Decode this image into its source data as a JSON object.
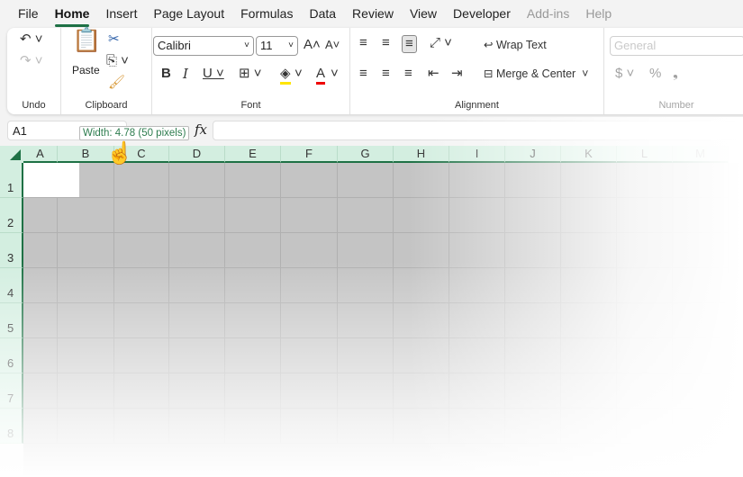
{
  "menu": [
    "File",
    "Home",
    "Insert",
    "Page Layout",
    "Formulas",
    "Data",
    "Review",
    "View",
    "Developer",
    "Add-ins",
    "Help"
  ],
  "ribbon": {
    "undo_label": "Undo",
    "clipboard_label": "Clipboard",
    "paste_label": "Paste",
    "font_label": "Font",
    "alignment_label": "Alignment",
    "number_label": "Number",
    "font_name": "Calibri",
    "font_size": "11",
    "wrap_text": "Wrap Text",
    "merge_center": "Merge & Center",
    "number_format": "General"
  },
  "formula_bar": {
    "name_box": "A1",
    "fx": "fx",
    "formula": ""
  },
  "tooltip": "Width: 4.78 (50 pixels)",
  "columns": [
    "A",
    "B",
    "C",
    "D",
    "E",
    "F",
    "G",
    "H",
    "I",
    "J",
    "K",
    "L",
    "M"
  ],
  "rows": [
    "1",
    "2",
    "3",
    "4",
    "5",
    "6",
    "7",
    "8"
  ],
  "colors": {
    "accent": "#1e7145",
    "header": "#d3eee0"
  }
}
